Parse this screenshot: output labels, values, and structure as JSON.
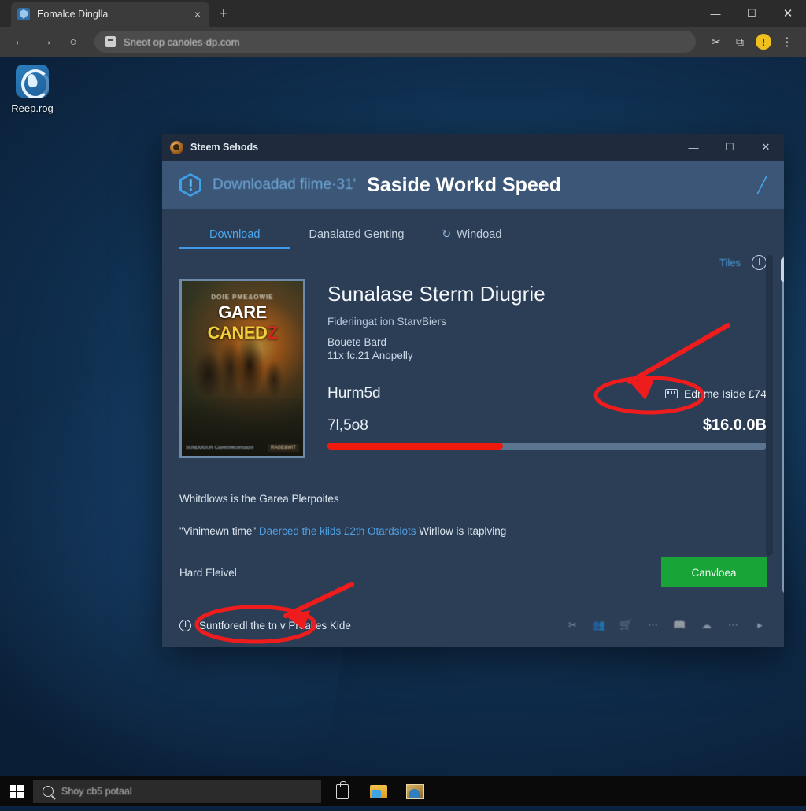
{
  "browser": {
    "tab": {
      "title": "Eomalce Dinglla",
      "favicon": "shield-icon",
      "close": "×"
    },
    "new_tab": "+",
    "window_controls": {
      "minimize": "—",
      "maximize": "☐",
      "close": "✕"
    },
    "nav": {
      "back": "←",
      "forward": "→",
      "reload": "○"
    },
    "url": {
      "value": "Sneot op canoles·dp.com",
      "lock": "lock-icon"
    },
    "actions": {
      "cut": "✂",
      "clipboard": "⧉",
      "alert_badge": "!",
      "menu": "⋮"
    }
  },
  "desktop": {
    "shortcut": {
      "label": "Reep.rog",
      "icon": "app-icon"
    }
  },
  "dialog": {
    "titlebar": {
      "title": "Steem Sehods",
      "logo": "steam-logo-icon"
    },
    "window_controls": {
      "minimize": "—",
      "maximize": "☐",
      "close": "✕"
    },
    "header": {
      "status_icon": "warning-hexagon-icon",
      "subtitle": "Downloadad fiime·31'",
      "title": "Saside Workd Speed",
      "edit_icon": "╱"
    },
    "tabs": [
      {
        "label": "Download",
        "active": true
      },
      {
        "label": "Danalated Genting",
        "active": false
      },
      {
        "label": "Windoad",
        "active": false,
        "icon": "refresh-icon"
      }
    ],
    "toolbar": {
      "tiles_link": "Tiles",
      "power_icon": "power-icon"
    },
    "card": {
      "cover": {
        "kicker": "DOIE PME&OWIE",
        "title_parts": [
          "GARE ",
          "CANED",
          "Z"
        ],
        "badge_left": "SUNDOGUN\nCavecmeconsauni",
        "badge_right": "RAGE&WIT"
      },
      "title": "Sunalase Sterm Diugrie",
      "subtitle": "Fideriingat ion StarvBiers",
      "line1": "Bouete Bard",
      "line2": "11x fc.21 Anopelly",
      "stat_label": "Hurm5d",
      "stat_badge": {
        "icon": "keyboard-icon",
        "text": "Edrime Iside £74"
      },
      "size_left": "7l,5o8",
      "size_right": "$16.0.0B",
      "progress_percent": 40,
      "progress_color": "#f01a0c"
    },
    "notes": {
      "line1": "Whitdlows is the Garea Plerpoites",
      "line2_quote": "\"Vinimewn time\"",
      "line2_link": "Daerced the kiids £2th Otardslots",
      "line2_tail": "Wirllow is Itaplving",
      "line3": "Hard Eleivel",
      "cta_label": "Canvloea",
      "cta_color": "#18a437"
    },
    "footer": {
      "status": "Suntforedl the tn v Prealles Kide",
      "power_icon": "power-icon",
      "icons": [
        "cut-icon",
        "people-icon",
        "cart-icon",
        "dots-icon",
        "book-icon",
        "cloud-icon",
        "dots2-icon",
        "caret-icon"
      ]
    }
  },
  "taskbar": {
    "start": "start-icon",
    "search": {
      "placeholder": "Shoy cb5 potaal",
      "icon": "search-icon"
    },
    "icons": [
      "bag-icon",
      "folder-icon",
      "photos-icon"
    ]
  },
  "annotations": {
    "circle1_target": "stat-badge",
    "circle2_target": "footer-status",
    "color": "#ee1c1c"
  }
}
